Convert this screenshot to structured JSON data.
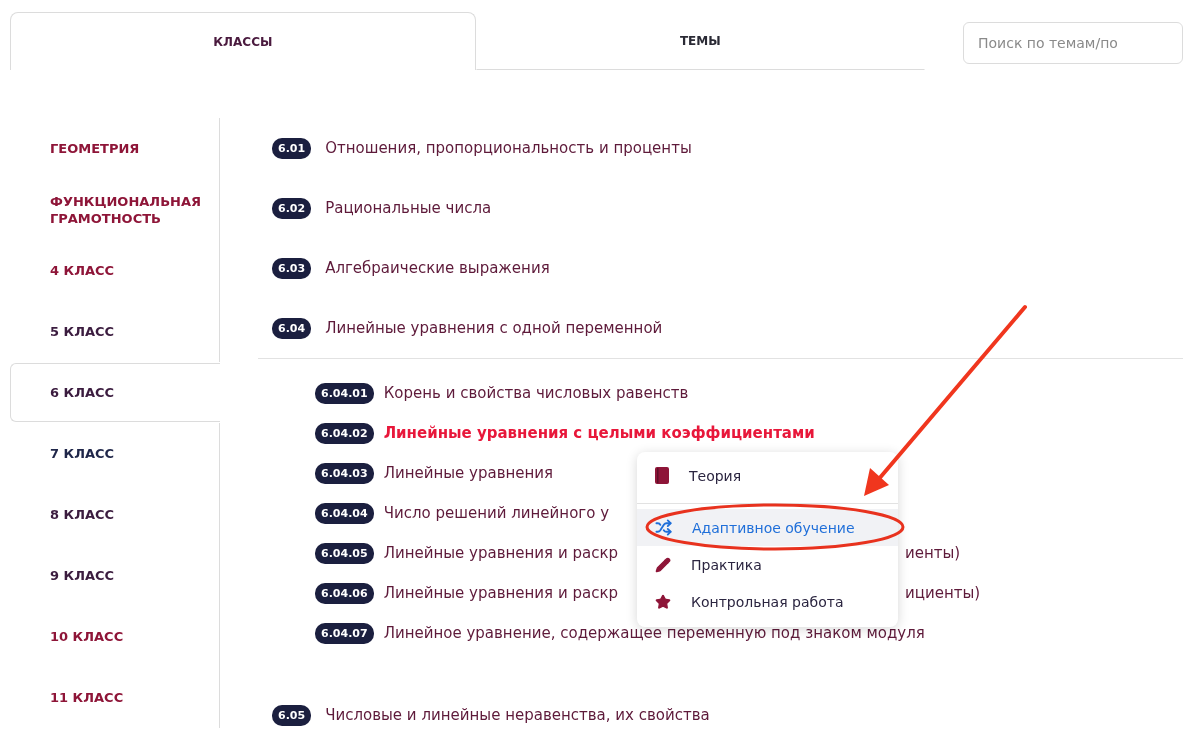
{
  "tabs": [
    {
      "label": "КЛАССЫ",
      "selected": true
    },
    {
      "label": "ТЕМЫ",
      "selected": false
    }
  ],
  "search": {
    "placeholder": "Поиск по темам/по"
  },
  "sidebar": {
    "items": [
      {
        "label": "ГЕОМЕТРИЯ",
        "selected": false,
        "color": "#8e1538"
      },
      {
        "label": "ФУНКЦИОНАЛЬНАЯ ГРАМОТНОСТЬ",
        "selected": false,
        "color": "#8e1538"
      },
      {
        "label": "4 КЛАСС",
        "selected": false,
        "color": "#8e1538"
      },
      {
        "label": "5 КЛАСС",
        "selected": false,
        "color": "#3b1c3f"
      },
      {
        "label": "6 КЛАСС",
        "selected": true,
        "color": "#3b1c3f"
      },
      {
        "label": "7 КЛАСС",
        "selected": false,
        "color": "#1f2649"
      },
      {
        "label": "8 КЛАСС",
        "selected": false,
        "color": "#3b1c3f"
      },
      {
        "label": "9 КЛАСС",
        "selected": false,
        "color": "#3b1c3f"
      },
      {
        "label": "10 КЛАСС",
        "selected": false,
        "color": "#8e1538"
      },
      {
        "label": "11 КЛАСС",
        "selected": false,
        "color": "#8e1538"
      }
    ]
  },
  "topics": [
    {
      "code": "6.01",
      "title": "Отношения, пропорциональность и проценты"
    },
    {
      "code": "6.02",
      "title": "Рациональные числа"
    },
    {
      "code": "6.03",
      "title": "Алгебраические выражения"
    },
    {
      "code": "6.04",
      "title": "Линейные уравнения с одной переменной",
      "children": [
        {
          "code": "6.04.01",
          "title": "Корень и свойства числовых равенств",
          "selected": false
        },
        {
          "code": "6.04.02",
          "title": "Линейные уравнения с целыми коэффициентами",
          "selected": true
        },
        {
          "code": "6.04.03",
          "title": "Линейные уравнения",
          "selected": false
        },
        {
          "code": "6.04.04",
          "title": "Число решений линейного у",
          "selected": false
        },
        {
          "code": "6.04.05",
          "title": "Линейные уравнения и раскр",
          "title_tail": "иенты)",
          "selected": false
        },
        {
          "code": "6.04.06",
          "title": "Линейные уравнения и раскр",
          "title_tail": "ициенты)",
          "selected": false
        },
        {
          "code": "6.04.07",
          "title": "Линейное уравнение, содержащее переменную под знаком модуля",
          "selected": false
        }
      ]
    },
    {
      "code": "6.05",
      "title": "Числовые и линейные неравенства, их свойства"
    }
  ],
  "menu": {
    "items": [
      {
        "kind": "book",
        "label": "Теория",
        "selected": false
      },
      {
        "kind": "shuffle",
        "label": "Адаптивное обучение",
        "selected": true
      },
      {
        "kind": "pencil",
        "label": "Практика",
        "selected": false
      },
      {
        "kind": "star",
        "label": "Контрольная работа",
        "selected": false
      }
    ]
  }
}
